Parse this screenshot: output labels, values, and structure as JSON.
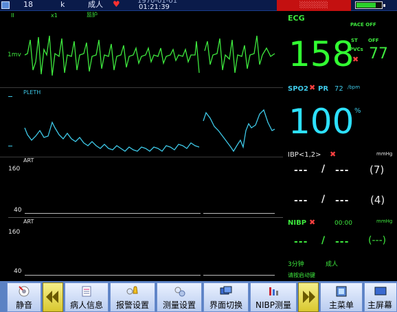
{
  "topbar": {
    "bed": "18",
    "unit": "k",
    "patient_type": "成人",
    "date": "1970-01-01",
    "time": "01:21:39",
    "mode": "监护",
    "alarm_text": "░░░░░░"
  },
  "waves": {
    "ecg_lead": "II",
    "ecg_gain": "x1",
    "ecg_mode": "监护",
    "ecg_scale": "1mv",
    "pleth_label": "PLETH",
    "art1_label": "ART",
    "art1_hi": "160",
    "art1_lo": "40",
    "art2_label": "ART",
    "art2_hi": "160",
    "art2_lo": "40"
  },
  "params": {
    "ecg": {
      "title": "ECG",
      "pace": "PACE OFF",
      "hr": "158",
      "st_label": "ST",
      "st_value": "OFF",
      "pvcs_label": "PVCs",
      "pvcs_value": "77"
    },
    "spo2": {
      "title": "SPO2",
      "pr_label": "PR",
      "pr_value": "72",
      "pr_unit": "/bpm",
      "value": "100",
      "unit": "%"
    },
    "ibp": {
      "title": "IBP<1,2>",
      "unit": "mmHg",
      "ch1_sys": "---",
      "ch1_sep": "/",
      "ch1_dia": "---",
      "ch1_mean": "(7)",
      "ch2_sys": "---",
      "ch2_sep": "/",
      "ch2_dia": "---",
      "ch2_mean": "(4)"
    },
    "nibp": {
      "title": "NIBP",
      "timer": "00:00",
      "unit": "mmHg",
      "sys": "---",
      "sep": "/",
      "dia": "---",
      "mean": "(---)",
      "interval": "3分钟",
      "patient": "成人",
      "hint": "请按启动键"
    }
  },
  "toolbar": {
    "mute": "静音",
    "patient_info": "病人信息",
    "alarm_settings": "报警设置",
    "measure_settings": "测量设置",
    "screen_switch": "界面切换",
    "nibp_measure": "NIBP测量",
    "main_menu": "主菜单",
    "main_screen": "主屏幕"
  },
  "colors": {
    "ecg": "#32ff32",
    "spo2": "#2de1ff",
    "toolbar": "#5b82c4",
    "alarm": "#c41010"
  }
}
